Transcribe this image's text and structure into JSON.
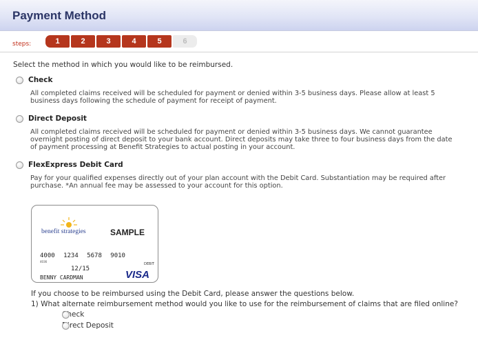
{
  "header": {
    "title": "Payment Method"
  },
  "steps": {
    "label": "steps:",
    "items": [
      {
        "label": "1",
        "state": "active"
      },
      {
        "label": "2",
        "state": "active"
      },
      {
        "label": "3",
        "state": "active"
      },
      {
        "label": "4",
        "state": "active"
      },
      {
        "label": "5",
        "state": "active"
      },
      {
        "label": "6",
        "state": "disabled"
      }
    ]
  },
  "intro": "Select the method in which you would like to be reimbursed.",
  "options": [
    {
      "title": "Check",
      "description": "All completed claims received will be scheduled for payment or denied within 3-5 business days. Please allow at least 5 business days following the schedule of payment for receipt of payment."
    },
    {
      "title": "Direct Deposit",
      "description": "All completed claims received will be scheduled for payment or denied within 3-5 business days. We cannot guarantee overnight posting of direct deposit to your bank account. Direct deposits may take three to four business days from the date of payment processing at Benefit Strategies to actual posting in your account."
    },
    {
      "title": "FlexExpress Debit Card",
      "description": "Pay for your qualified expenses directly out of your plan account with the Debit Card. Substantiation may be required after purchase. *An annual fee may be assessed to your account for this option."
    }
  ],
  "card": {
    "brand": "benefit strategies",
    "sample": "SAMPLE",
    "number": "4000 1234 5678 9010",
    "small_number": "4036",
    "expiry": "12/15",
    "holder": "BENNY CARDMAN",
    "debit": "DEBIT",
    "network": "VISA"
  },
  "questions": {
    "intro": "If you choose to be reimbursed using the Debit Card, please answer the questions below.",
    "q1": "1) What alternate reimbursement method would you like to use for the reimbursement of claims that are filed online?",
    "q1_options": [
      "Check",
      "Direct Deposit"
    ]
  }
}
